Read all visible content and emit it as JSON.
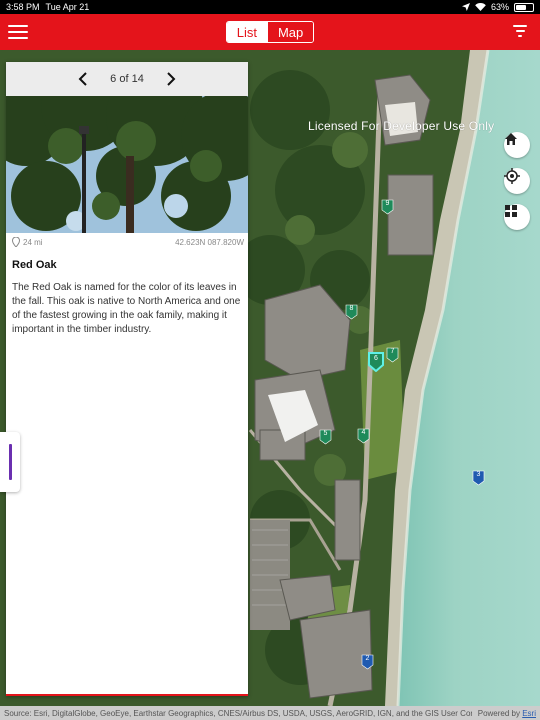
{
  "status_bar": {
    "time": "3:58 PM",
    "date": "Tue Apr 21",
    "battery": "63%"
  },
  "nav": {
    "tabs": [
      {
        "label": "List",
        "selected": false
      },
      {
        "label": "Map",
        "selected": true
      }
    ],
    "menu_icon": "hamburger-menu-icon",
    "filter_icon": "filter-icon",
    "accent_color": "#e4141b"
  },
  "panel": {
    "pager_text": "6 of 14",
    "distance": "24 mi",
    "coordinates": "42.623N 087.820W",
    "title": "Red Oak",
    "description": "The Red Oak is named for the color of its leaves in the fall. This oak is native to North America and one of the fastest growing in the oak family, making it important in the timber industry."
  },
  "map": {
    "license_text": "Licensed For Developer Use Only",
    "controls": [
      "home-icon",
      "locate-icon",
      "basemap-gallery-icon"
    ],
    "markers": [
      {
        "label": "9",
        "selected": false
      },
      {
        "label": "8",
        "selected": false
      },
      {
        "label": "6",
        "selected": true
      },
      {
        "label": "7",
        "selected": false
      },
      {
        "label": "5",
        "selected": false
      },
      {
        "label": "4",
        "selected": false
      },
      {
        "label": "3",
        "selected": false
      },
      {
        "label": "2",
        "selected": false
      }
    ],
    "attribution": "Source: Esri, DigitalGlobe, GeoEye, Earthstar Geographics, CNES/Airbus DS, USDA, USGS, AeroGRID, IGN, and the GIS User Community",
    "powered_by_prefix": "Powered by",
    "powered_by_link": "Esri"
  }
}
